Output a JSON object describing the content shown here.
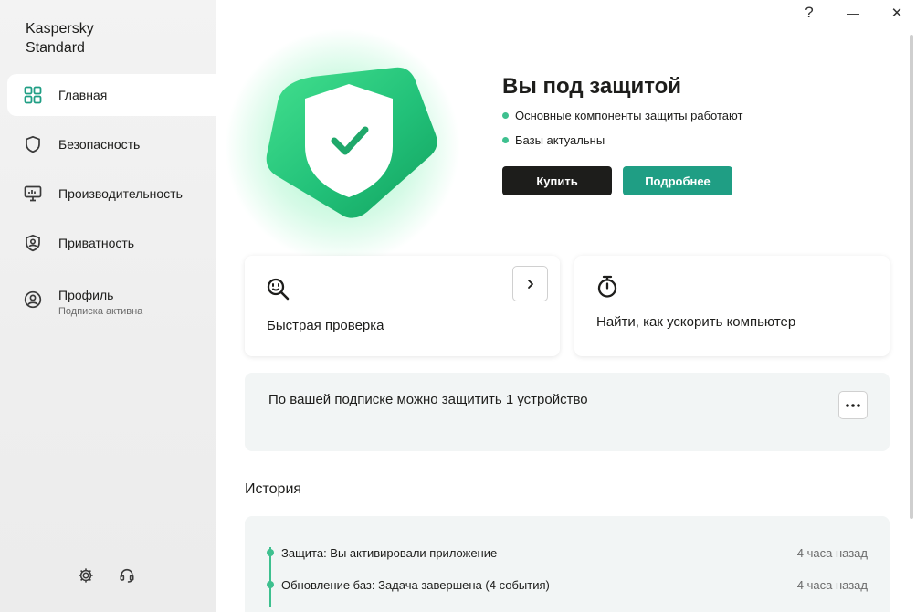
{
  "app": {
    "title_line1": "Kaspersky",
    "title_line2": "Standard"
  },
  "window": {
    "help": "?",
    "minimize": "—",
    "close": "✕"
  },
  "sidebar": {
    "items": [
      {
        "label": "Главная",
        "icon": "home-grid-icon",
        "active": true
      },
      {
        "label": "Безопасность",
        "icon": "shield-icon"
      },
      {
        "label": "Производительность",
        "icon": "monitor-icon"
      },
      {
        "label": "Приватность",
        "icon": "privacy-shield-icon"
      },
      {
        "label": "Профиль",
        "sub": "Подписка активна",
        "icon": "user-icon"
      }
    ],
    "bottom": {
      "settings_icon": "gear-icon",
      "support_icon": "headset-icon"
    }
  },
  "hero": {
    "title": "Вы под защитой",
    "status": [
      "Основные компоненты защиты работают",
      "Базы актуальны"
    ],
    "buy_label": "Купить",
    "more_label": "Подробнее"
  },
  "cards": {
    "scan": {
      "title": "Быстрая проверка",
      "icon": "scan-search-icon"
    },
    "speed": {
      "title": "Найти, как ускорить компьютер",
      "icon": "stopwatch-icon"
    }
  },
  "subscription": {
    "text": "По вашей подписке можно защитить 1 устройство"
  },
  "history": {
    "title": "История",
    "items": [
      {
        "text": "Защита: Вы активировали приложение",
        "time": "4 часа назад"
      },
      {
        "text": "Обновление баз: Задача завершена (4 события)",
        "time": "4 часа назад"
      }
    ]
  },
  "colors": {
    "accent_green": "#3ec08f",
    "button_dark": "#1d1d1b",
    "button_teal": "#1f9e84"
  }
}
